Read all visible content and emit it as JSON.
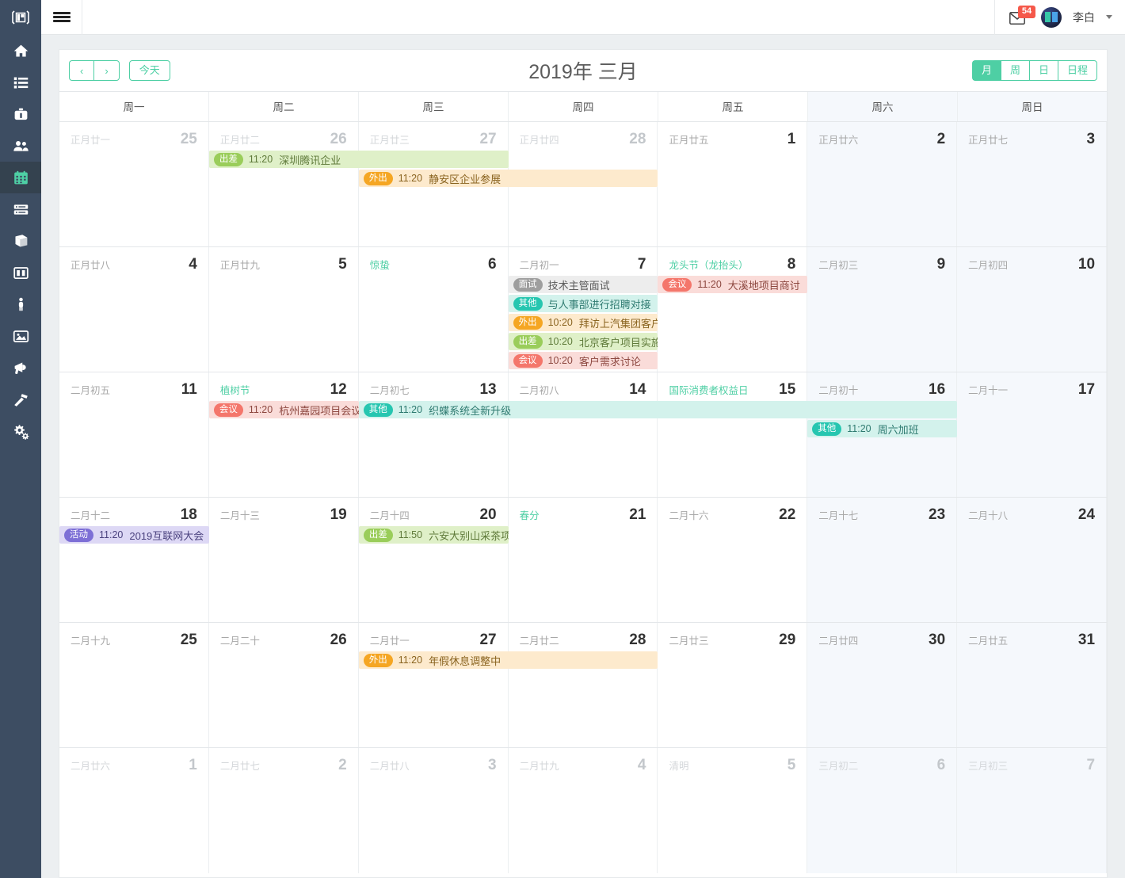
{
  "app": {
    "logo_icon": "panels-logo-icon",
    "menu_icon": "hamburger-icon",
    "mail_icon": "envelope-icon",
    "mail_badge": "54",
    "username": "李白",
    "caret_icon": "chevron-down-icon"
  },
  "sidebar": {
    "items": [
      {
        "icon": "home-icon",
        "name": "home",
        "active": false
      },
      {
        "icon": "list-icon",
        "name": "list",
        "active": false
      },
      {
        "icon": "briefcase-icon",
        "name": "briefcase",
        "active": false
      },
      {
        "icon": "users-icon",
        "name": "users",
        "active": false
      },
      {
        "icon": "calendar-icon",
        "name": "calendar",
        "active": true
      },
      {
        "icon": "server-icon",
        "name": "server",
        "active": false
      },
      {
        "icon": "book-icon",
        "name": "book",
        "active": false
      },
      {
        "icon": "columns-icon",
        "name": "columns",
        "active": false
      },
      {
        "icon": "person-icon",
        "name": "person",
        "active": false
      },
      {
        "icon": "image-icon",
        "name": "image",
        "active": false
      },
      {
        "icon": "megaphone-icon",
        "name": "megaphone",
        "active": false
      },
      {
        "icon": "hammer-icon",
        "name": "hammer",
        "active": false
      },
      {
        "icon": "gears-icon",
        "name": "gears",
        "active": false
      }
    ]
  },
  "toolbar": {
    "prev_label": "‹",
    "next_label": "›",
    "today_label": "今天",
    "title": "2019年 三月",
    "views": [
      {
        "label": "月",
        "active": true
      },
      {
        "label": "周",
        "active": false
      },
      {
        "label": "日",
        "active": false
      },
      {
        "label": "日程",
        "active": false
      }
    ]
  },
  "calendar": {
    "dow": [
      "周一",
      "周二",
      "周三",
      "周四",
      "周五",
      "周六",
      "周日"
    ],
    "weeks": [
      {
        "days": [
          {
            "lunar": "正月廿一",
            "num": "25",
            "other": true
          },
          {
            "lunar": "正月廿二",
            "num": "26",
            "other": true
          },
          {
            "lunar": "正月廿三",
            "num": "27",
            "other": true
          },
          {
            "lunar": "正月廿四",
            "num": "28",
            "other": true
          },
          {
            "lunar": "正月廿五",
            "num": "1",
            "other": false
          },
          {
            "lunar": "正月廿六",
            "num": "2",
            "other": false,
            "weekend": true
          },
          {
            "lunar": "正月廿七",
            "num": "3",
            "other": false,
            "weekend": true
          }
        ],
        "events": [
          {
            "tag": "出差",
            "time": "11:20",
            "title": "深圳腾讯企业",
            "start": 1,
            "span": 2,
            "row": 0,
            "kind": "chuchai"
          },
          {
            "tag": "外出",
            "time": "11:20",
            "title": "静安区企业参展",
            "start": 2,
            "span": 2,
            "row": 1,
            "kind": "waichu"
          }
        ]
      },
      {
        "days": [
          {
            "lunar": "正月廿八",
            "num": "4",
            "other": false
          },
          {
            "lunar": "正月廿九",
            "num": "5",
            "other": false
          },
          {
            "lunar": "惊蛰",
            "num": "6",
            "other": false,
            "fest": true
          },
          {
            "lunar": "二月初一",
            "num": "7",
            "other": false
          },
          {
            "lunar": "龙头节（龙抬头）",
            "num": "8",
            "other": false,
            "fest": true
          },
          {
            "lunar": "二月初三",
            "num": "9",
            "other": false,
            "weekend": true
          },
          {
            "lunar": "二月初四",
            "num": "10",
            "other": false,
            "weekend": true
          }
        ],
        "events": [
          {
            "tag": "面试",
            "time": "",
            "title": "技术主管面试",
            "start": 3,
            "span": 1,
            "row": 0,
            "kind": "mianshi"
          },
          {
            "tag": "其他",
            "time": "",
            "title": "与人事部进行招聘对接",
            "start": 3,
            "span": 1,
            "row": 1,
            "kind": "qita"
          },
          {
            "tag": "外出",
            "time": "10:20",
            "title": "拜访上汽集团客户",
            "start": 3,
            "span": 1,
            "row": 2,
            "kind": "waichu"
          },
          {
            "tag": "出差",
            "time": "10:20",
            "title": "北京客户项目实施",
            "start": 3,
            "span": 1,
            "row": 3,
            "kind": "chuchai"
          },
          {
            "tag": "会议",
            "time": "10:20",
            "title": "客户需求讨论",
            "start": 3,
            "span": 1,
            "row": 4,
            "kind": "huiyi"
          },
          {
            "tag": "会议",
            "time": "11:20",
            "title": "大溪地项目商讨",
            "start": 4,
            "span": 1,
            "row": 0,
            "kind": "huiyi"
          }
        ]
      },
      {
        "days": [
          {
            "lunar": "二月初五",
            "num": "11",
            "other": false
          },
          {
            "lunar": "植树节",
            "num": "12",
            "other": false,
            "fest": true
          },
          {
            "lunar": "二月初七",
            "num": "13",
            "other": false
          },
          {
            "lunar": "二月初八",
            "num": "14",
            "other": false
          },
          {
            "lunar": "国际消费者权益日",
            "num": "15",
            "other": false,
            "fest": true
          },
          {
            "lunar": "二月初十",
            "num": "16",
            "other": false,
            "weekend": true
          },
          {
            "lunar": "二月十一",
            "num": "17",
            "other": false,
            "weekend": true
          }
        ],
        "events": [
          {
            "tag": "会议",
            "time": "11:20",
            "title": "杭州嘉园项目会议",
            "start": 1,
            "span": 1,
            "row": 0,
            "kind": "huiyi"
          },
          {
            "tag": "其他",
            "time": "11:20",
            "title": "织蝶系统全新升级",
            "start": 2,
            "span": 4,
            "row": 0,
            "kind": "qita"
          },
          {
            "tag": "其他",
            "time": "11:20",
            "title": "周六加班",
            "start": 5,
            "span": 1,
            "row": 1,
            "kind": "qita"
          }
        ]
      },
      {
        "days": [
          {
            "lunar": "二月十二",
            "num": "18",
            "other": false
          },
          {
            "lunar": "二月十三",
            "num": "19",
            "other": false
          },
          {
            "lunar": "二月十四",
            "num": "20",
            "other": false
          },
          {
            "lunar": "春分",
            "num": "21",
            "other": false,
            "fest": true
          },
          {
            "lunar": "二月十六",
            "num": "22",
            "other": false
          },
          {
            "lunar": "二月十七",
            "num": "23",
            "other": false,
            "weekend": true
          },
          {
            "lunar": "二月十八",
            "num": "24",
            "other": false,
            "weekend": true
          }
        ],
        "events": [
          {
            "tag": "活动",
            "time": "11:20",
            "title": "2019互联网大会",
            "start": 0,
            "span": 1,
            "row": 0,
            "kind": "huodong"
          },
          {
            "tag": "出差",
            "time": "11:50",
            "title": "六安大别山采茶项目",
            "start": 2,
            "span": 1,
            "row": 0,
            "kind": "chuchai"
          }
        ]
      },
      {
        "days": [
          {
            "lunar": "二月十九",
            "num": "25",
            "other": false
          },
          {
            "lunar": "二月二十",
            "num": "26",
            "other": false
          },
          {
            "lunar": "二月廿一",
            "num": "27",
            "other": false
          },
          {
            "lunar": "二月廿二",
            "num": "28",
            "other": false
          },
          {
            "lunar": "二月廿三",
            "num": "29",
            "other": false
          },
          {
            "lunar": "二月廿四",
            "num": "30",
            "other": false,
            "weekend": true
          },
          {
            "lunar": "二月廿五",
            "num": "31",
            "other": false,
            "weekend": true
          }
        ],
        "events": [
          {
            "tag": "外出",
            "time": "11:20",
            "title": "年假休息调整中",
            "start": 2,
            "span": 2,
            "row": 0,
            "kind": "waichu"
          }
        ]
      },
      {
        "days": [
          {
            "lunar": "二月廿六",
            "num": "1",
            "other": true
          },
          {
            "lunar": "二月廿七",
            "num": "2",
            "other": true
          },
          {
            "lunar": "二月廿八",
            "num": "3",
            "other": true
          },
          {
            "lunar": "二月廿九",
            "num": "4",
            "other": true
          },
          {
            "lunar": "清明",
            "num": "5",
            "other": true,
            "festDim": true
          },
          {
            "lunar": "三月初二",
            "num": "6",
            "other": true,
            "weekend": true
          },
          {
            "lunar": "三月初三",
            "num": "7",
            "other": true,
            "weekend": true
          }
        ],
        "events": []
      }
    ],
    "event_colors": {
      "chuchai": {
        "tag": "#9acd5a",
        "bg": "#dff0c8",
        "text": "#5f7a3a"
      },
      "waichu": {
        "tag": "#f5a623",
        "bg": "#fdeacd",
        "text": "#8a6420"
      },
      "mianshi": {
        "tag": "#9e9e9e",
        "bg": "#ededed",
        "text": "#5a5a5a"
      },
      "qita": {
        "tag": "#26c6b0",
        "bg": "#d3f2ec",
        "text": "#2e7a70"
      },
      "huiyi": {
        "tag": "#f4766b",
        "bg": "#fadcd9",
        "text": "#8d4840"
      },
      "huodong": {
        "tag": "#7d6fd6",
        "bg": "#ddd8f5",
        "text": "#4b427f"
      }
    }
  }
}
